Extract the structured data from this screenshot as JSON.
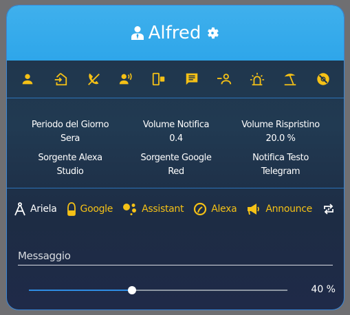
{
  "header": {
    "title": "Alfred",
    "left_icon": "person-tie-icon",
    "right_icon": "gear-icon"
  },
  "iconbar": {
    "color": "#f5c116",
    "icons": [
      "person-icon",
      "home-enter-icon",
      "phone-off-icon",
      "voice-broadcast-icon",
      "remote-devices-icon",
      "message-text-icon",
      "person-minus-icon",
      "alarm-light-icon",
      "beach-icon",
      "no-icon"
    ]
  },
  "info": {
    "periodo_label": "Periodo del Giorno",
    "periodo_value": "Sera",
    "volume_notifica_label": "Volume Notifica",
    "volume_notifica_value": "0.4",
    "volume_ripristino_label": "Volume Rispristino",
    "volume_ripristino_value": "20.0 %",
    "sorgente_alexa_label": "Sorgente Alexa",
    "sorgente_alexa_value": "Studio",
    "sorgente_google_label": "Sorgente Google",
    "sorgente_google_value": "Red",
    "notifica_testo_label": "Notifica Testo",
    "notifica_testo_value": "Telegram"
  },
  "services": {
    "ariela": "Ariela",
    "google": "Google",
    "assistant": "Assistant",
    "alexa": "Alexa",
    "announce": "Announce",
    "active_color": "#ffffff",
    "inactive_color": "#f5c116"
  },
  "message": {
    "placeholder": "Messaggio",
    "value": ""
  },
  "slider": {
    "value_fraction": 0.4,
    "value_label": "40 %",
    "fill_color": "#2f8de4"
  }
}
